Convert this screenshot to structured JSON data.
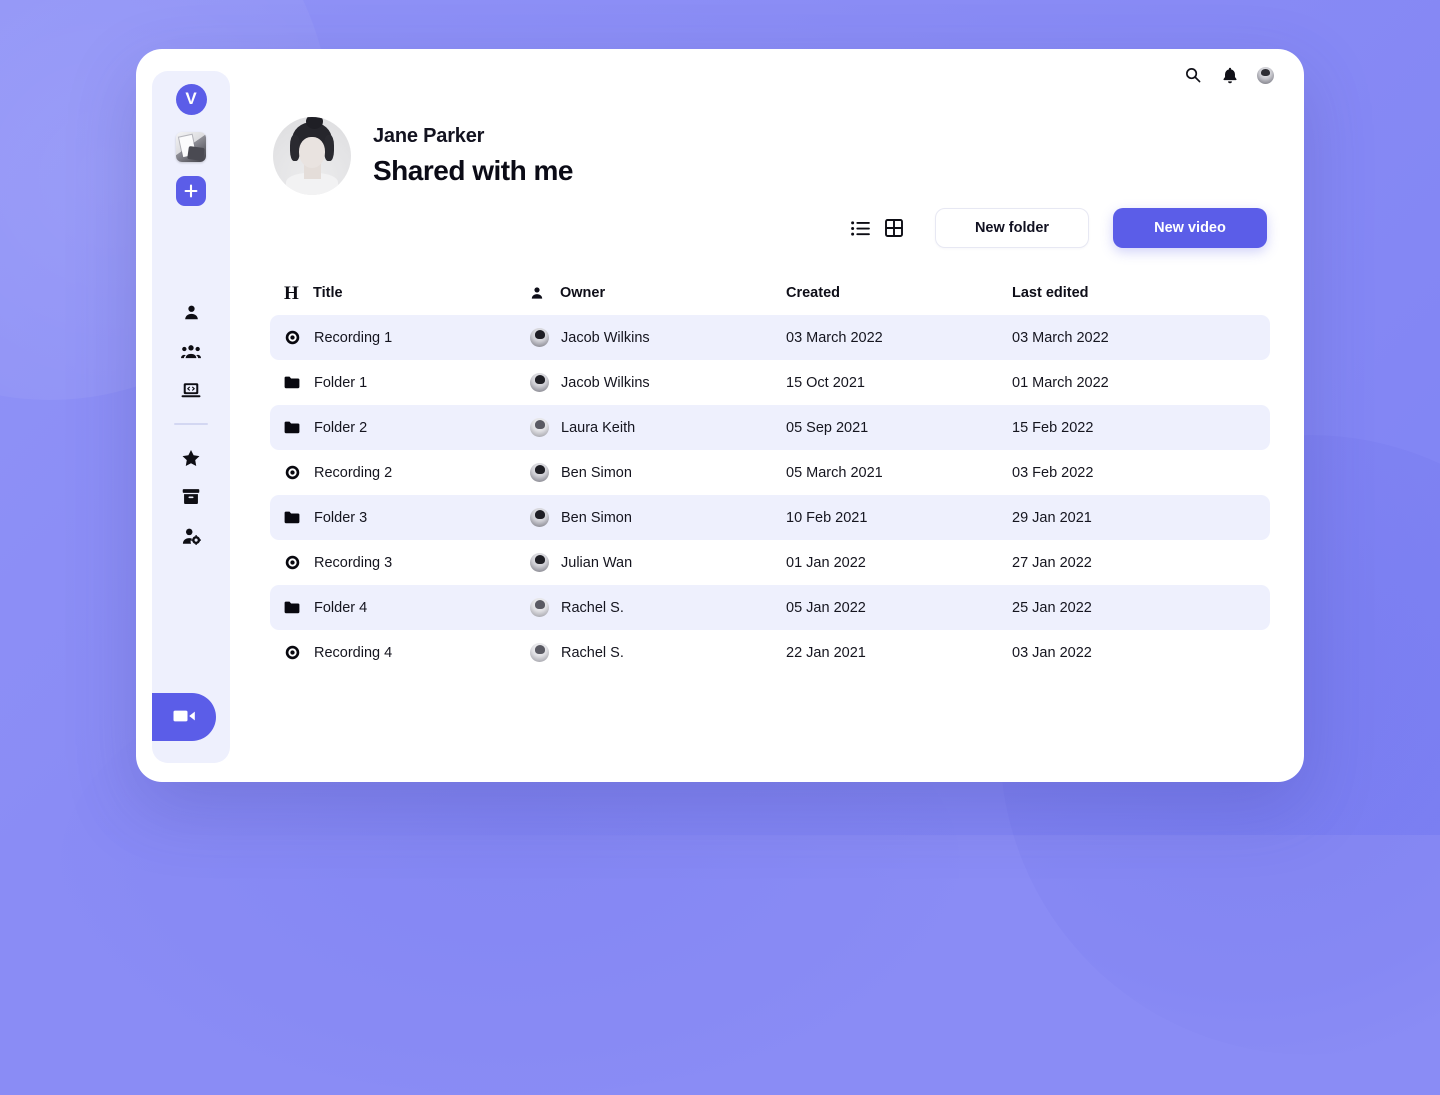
{
  "theme": {
    "accent": "#5b5de8",
    "card_bg": "#ffffff",
    "sidebar_bg": "#eef0fd",
    "row_alt_bg": "#eef0fd",
    "page_bg": "#8a8cf5",
    "text": "#15151f"
  },
  "sidebar": {
    "logo_label": "V",
    "workspace_thumb_icon": "workspace-photo-thumbnail",
    "add_button_icon": "plus-icon",
    "nav_items": [
      {
        "icon": "person-icon",
        "name": "sidebar-item-my-videos"
      },
      {
        "icon": "people-group-icon",
        "name": "sidebar-item-team"
      },
      {
        "icon": "laptop-code-icon",
        "name": "sidebar-item-embeds"
      }
    ],
    "nav_items_secondary": [
      {
        "icon": "star-icon",
        "name": "sidebar-item-favorites"
      },
      {
        "icon": "archive-box-icon",
        "name": "sidebar-item-archive"
      },
      {
        "icon": "person-settings-icon",
        "name": "sidebar-item-manage-users"
      }
    ],
    "record_button_icon": "video-camera-icon"
  },
  "topbar": {
    "search_icon": "search-icon",
    "notifications_icon": "bell-icon",
    "avatar_icon": "user-avatar"
  },
  "header": {
    "avatar_icon": "profile-avatar",
    "user_name": "Jane Parker",
    "page_title": "Shared with me"
  },
  "toolbar": {
    "list_view_icon": "list-view-icon",
    "grid_view_icon": "grid-view-icon",
    "new_folder_label": "New folder",
    "new_video_label": "New video"
  },
  "table": {
    "columns": {
      "title_icon": "heading-h-icon",
      "title": "Title",
      "owner_icon": "person-icon",
      "owner": "Owner",
      "created": "Created",
      "last_edited": "Last edited"
    },
    "rows": [
      {
        "icon": "recording-icon",
        "title": "Recording 1",
        "owner": "Jacob Wilkins",
        "avatar": "dark",
        "created": "03 March 2022",
        "last_edited": "03 March 2022",
        "highlighted": true
      },
      {
        "icon": "folder-icon",
        "title": "Folder 1",
        "owner": "Jacob Wilkins",
        "avatar": "dark",
        "created": "15 Oct 2021",
        "last_edited": "01 March 2022",
        "highlighted": false
      },
      {
        "icon": "folder-icon",
        "title": "Folder 2",
        "owner": "Laura Keith",
        "avatar": "light",
        "created": "05 Sep 2021",
        "last_edited": "15 Feb 2022",
        "highlighted": true
      },
      {
        "icon": "recording-icon",
        "title": "Recording 2",
        "owner": "Ben Simon",
        "avatar": "dark",
        "created": "05 March 2021",
        "last_edited": "03 Feb 2022",
        "highlighted": false
      },
      {
        "icon": "folder-icon",
        "title": "Folder 3",
        "owner": "Ben Simon",
        "avatar": "dark",
        "created": "10 Feb 2021",
        "last_edited": "29 Jan 2021",
        "highlighted": true
      },
      {
        "icon": "recording-icon",
        "title": "Recording 3",
        "owner": "Julian Wan",
        "avatar": "dark",
        "created": "01 Jan 2022",
        "last_edited": "27 Jan 2022",
        "highlighted": false
      },
      {
        "icon": "folder-icon",
        "title": "Folder 4",
        "owner": "Rachel S.",
        "avatar": "light",
        "created": "05 Jan 2022",
        "last_edited": "25 Jan 2022",
        "highlighted": true
      },
      {
        "icon": "recording-icon",
        "title": "Recording 4",
        "owner": "Rachel S.",
        "avatar": "light",
        "created": "22 Jan 2021",
        "last_edited": "03 Jan 2022",
        "highlighted": false
      }
    ]
  }
}
